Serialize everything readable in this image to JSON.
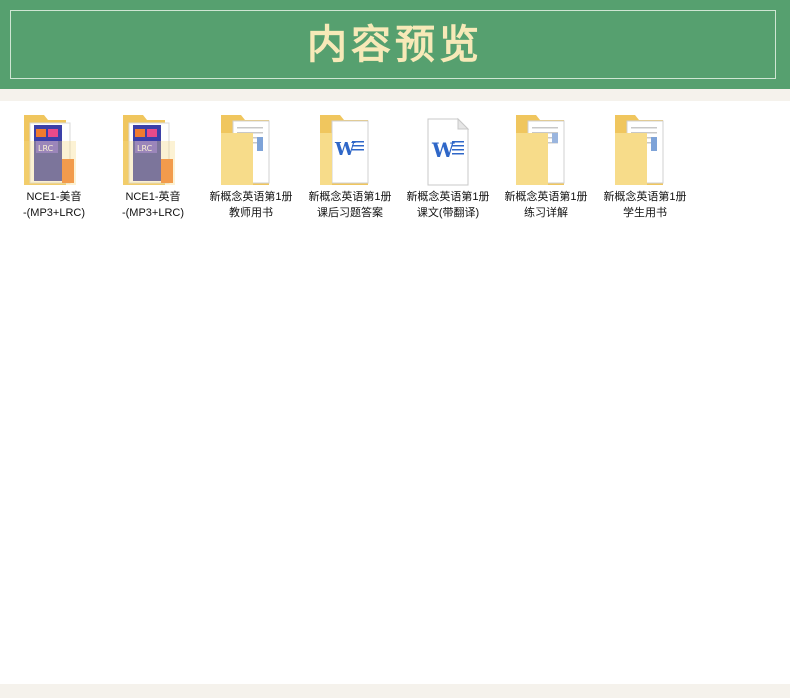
{
  "banner": {
    "title": "内容预览"
  },
  "files": [
    {
      "line1": "NCE1-美音",
      "line2": "-(MP3+LRC)",
      "icon": "folder-audio-icon"
    },
    {
      "line1": "NCE1-英音",
      "line2": "-(MP3+LRC)",
      "icon": "folder-audio-icon"
    },
    {
      "line1": "新概念英语第1册",
      "line2": "教师用书",
      "icon": "folder-document-icon"
    },
    {
      "line1": "新概念英语第1册",
      "line2": "课后习题答案",
      "icon": "folder-word-icon"
    },
    {
      "line1": "新概念英语第1册",
      "line2": "课文(带翻译)",
      "icon": "word-document-icon"
    },
    {
      "line1": "新概念英语第1册",
      "line2": "练习详解",
      "icon": "folder-document-icon"
    },
    {
      "line1": "新概念英语第1册",
      "line2": "学生用书",
      "icon": "folder-document-icon"
    }
  ],
  "colors": {
    "banner_bg": "#56a06f",
    "title": "#f7e9b8",
    "folder": "#f6d77d",
    "word_blue": "#2f67c8"
  }
}
